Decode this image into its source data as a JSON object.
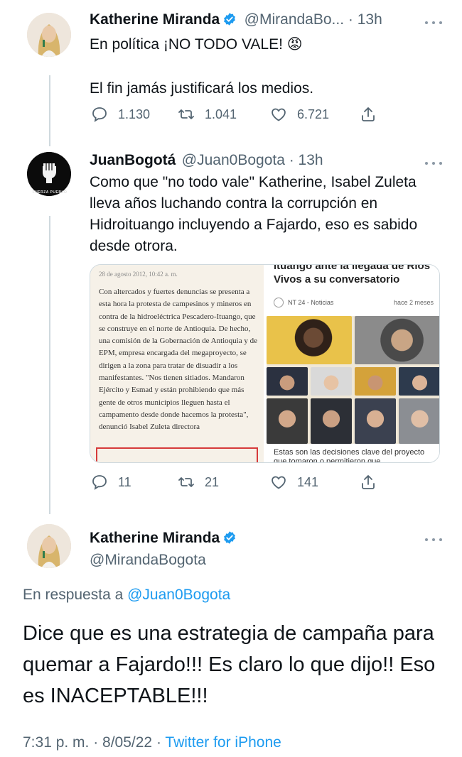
{
  "tweet1": {
    "name": "Katherine Miranda",
    "handle_time": "@MirandaBo... · 13h",
    "line1": "En política ¡NO TODO VALE! 😡",
    "line2": "El fin jamás justificará los medios.",
    "reply_count": "1.130",
    "retweet_count": "1.041",
    "like_count": "6.721"
  },
  "tweet2": {
    "name": "JuanBogotá",
    "handle_time": "@Juan0Bogota · 13h",
    "text": "Como que \"no todo vale\" Katherine, Isabel Zuleta lleva años luchando contra la corrupción en Hidroituango incluyendo a Fajardo, eso es sabido desde otrora.",
    "avatar_text": "FUERZA PUEBLO",
    "article": {
      "date": "28 de agosto 2012, 10:42 a. m.",
      "text": "Con altercados y fuertes denuncias se presenta a esta hora la protesta de campesinos y mineros en contra de la hidroeléctrica Pescadero-Ituango, que se construye en el norte de Antioquia. De hecho, una comisión de la Gobernación de Antioquia y de EPM, empresa encargada del megaproyecto, se dirigen a la zona para tratar de disuadir a los manifestantes. \"Nos tienen sitiados. Mandaron Ejército y Esmad y están prohibiendo que más gente de otros municipios lleguen hasta el campamento desde donde hacemos la protesta\", denunció Isabel Zuleta directora"
    },
    "news": {
      "headline": "ituango ante la llegada de Ríos Vivos a su conversatorio",
      "source": "NT 24 - Noticias",
      "time": "hace 2 meses",
      "caption": "Estas son las decisiones clave del proyecto que tomaron o permitieron que"
    },
    "reply_count": "11",
    "retweet_count": "21",
    "like_count": "141"
  },
  "tweet3": {
    "name": "Katherine Miranda",
    "handle": "@MirandaBogota",
    "reply_prefix": "En respuesta a",
    "reply_to": "@Juan0Bogota",
    "text": "Dice que es una estrategia de campaña para quemar a Fajardo!!! Es claro lo que dijo!! Eso es INACEPTABLE!!!",
    "timestamp": "7:31 p. m. · 8/05/22 · ",
    "source": "Twitter for iPhone"
  },
  "colors": {
    "accent": "#1d9bf0",
    "secondary_text": "#536471",
    "highlight_box": "#d63a3a"
  },
  "icons": {
    "reply": "comment-icon",
    "retweet": "retweet-icon",
    "like": "heart-icon",
    "share": "share-icon",
    "verified": "verified-badge-icon",
    "more": "more-icon"
  }
}
